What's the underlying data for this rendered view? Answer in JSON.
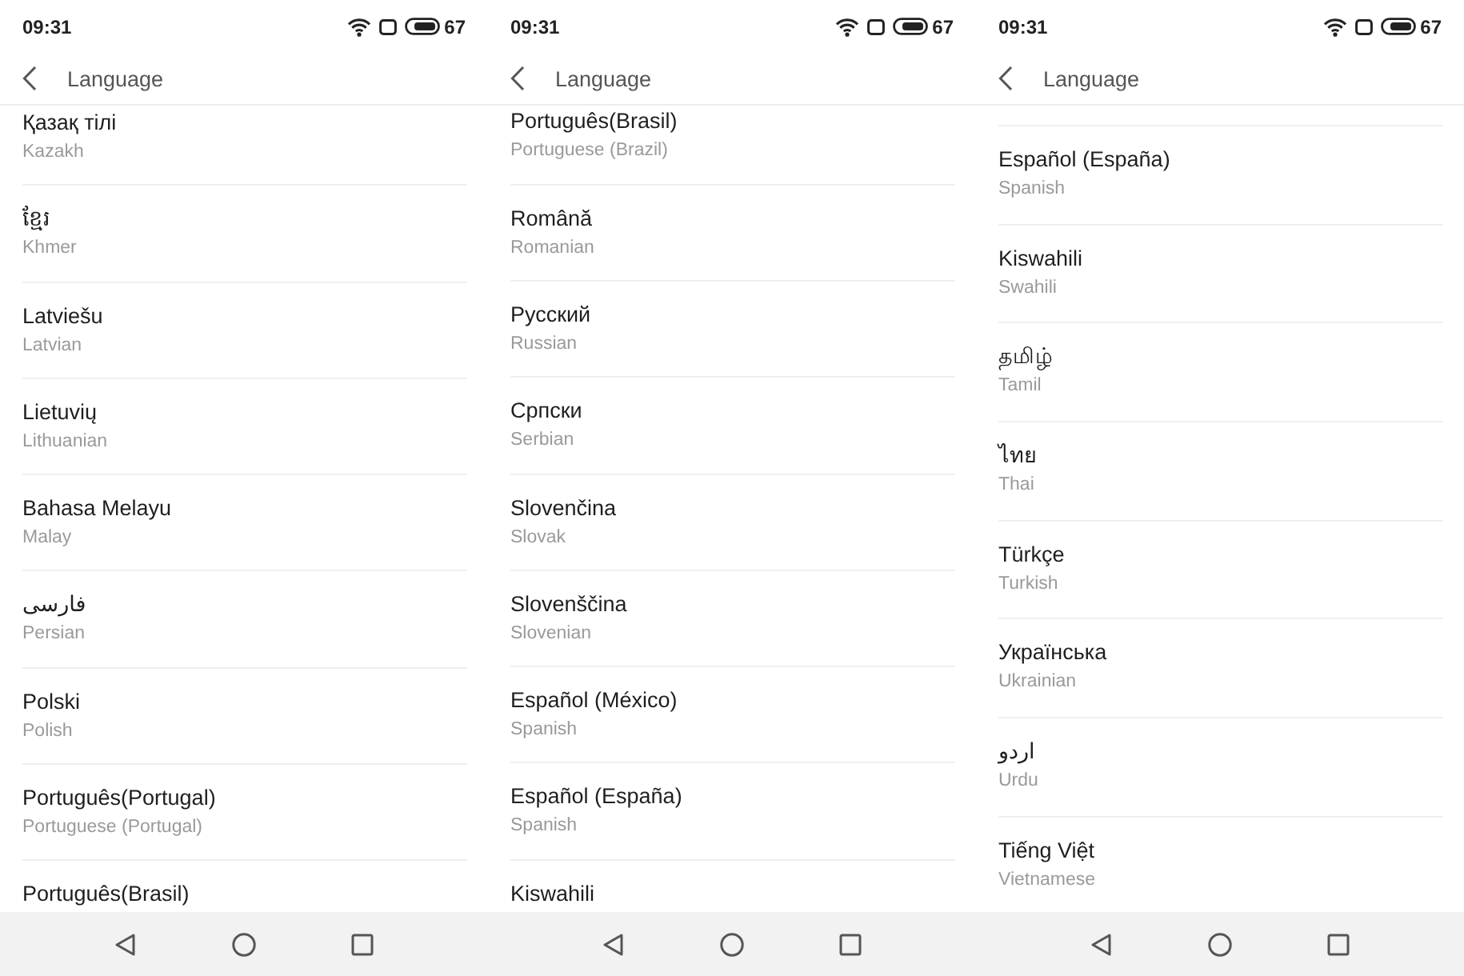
{
  "screens": [
    {
      "status_bar": {
        "time": "09:31",
        "battery": "67"
      },
      "header": {
        "title": "Language"
      },
      "languages": [
        {
          "name": "Қазақ тілі",
          "english": "Kazakh"
        },
        {
          "name": "ខ្មែរ",
          "english": "Khmer"
        },
        {
          "name": "Latviešu",
          "english": "Latvian"
        },
        {
          "name": "Lietuvių",
          "english": "Lithuanian"
        },
        {
          "name": "Bahasa Melayu",
          "english": "Malay"
        },
        {
          "name": "فارسی",
          "english": "Persian"
        },
        {
          "name": "Polski",
          "english": "Polish"
        },
        {
          "name": "Português(Portugal)",
          "english": "Portuguese (Portugal)"
        },
        {
          "name": "Português(Brasil)"
        }
      ]
    },
    {
      "status_bar": {
        "time": "09:31",
        "battery": "67"
      },
      "header": {
        "title": "Language"
      },
      "languages": [
        {
          "name": "Português(Brasil)",
          "english": "Portuguese (Brazil)"
        },
        {
          "name": "Română",
          "english": "Romanian"
        },
        {
          "name": "Русский",
          "english": "Russian"
        },
        {
          "name": "Српски",
          "english": "Serbian"
        },
        {
          "name": "Slovenčina",
          "english": "Slovak"
        },
        {
          "name": "Slovenščina",
          "english": "Slovenian"
        },
        {
          "name": "Español (México)",
          "english": "Spanish"
        },
        {
          "name": "Español (España)",
          "english": "Spanish"
        },
        {
          "name": "Kiswahili"
        }
      ]
    },
    {
      "status_bar": {
        "time": "09:31",
        "battery": "67"
      },
      "header": {
        "title": "Language"
      },
      "languages": [
        {
          "name": "Español (España)",
          "english": "Spanish"
        },
        {
          "name": "Kiswahili",
          "english": "Swahili"
        },
        {
          "name": "தமிழ்",
          "english": "Tamil"
        },
        {
          "name": "ไทย",
          "english": "Thai"
        },
        {
          "name": "Türkçe",
          "english": "Turkish"
        },
        {
          "name": "Українська",
          "english": "Ukrainian"
        },
        {
          "name": "اردو",
          "english": "Urdu"
        },
        {
          "name": "Tiếng Việt",
          "english": "Vietnamese"
        }
      ]
    }
  ]
}
